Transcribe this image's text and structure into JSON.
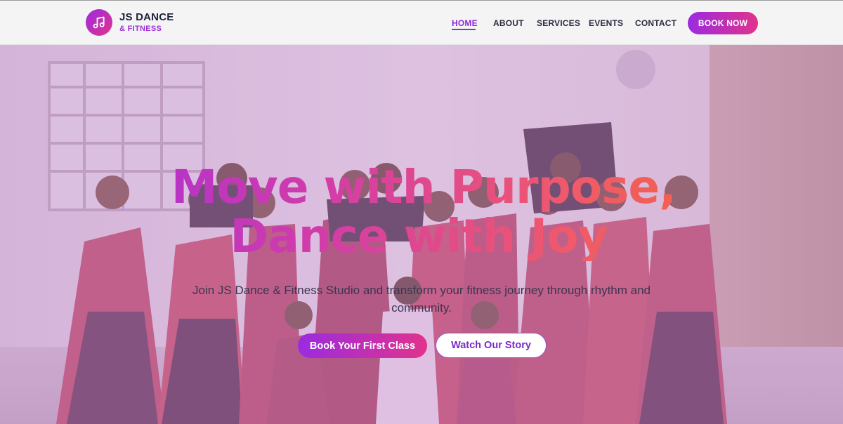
{
  "brand": {
    "name": "JS DANCE",
    "tagline": "& FITNESS",
    "logo_icon": "music-note-icon",
    "gradient": [
      "#9b2be0",
      "#e1338c"
    ]
  },
  "nav": {
    "items": [
      {
        "label": "HOME",
        "active": true
      },
      {
        "label": "ABOUT",
        "active": false
      },
      {
        "label": "SERVICES",
        "active": false
      },
      {
        "label": "EVENTS",
        "active": false
      },
      {
        "label": "CONTACT",
        "active": false
      }
    ],
    "cta": "BOOK NOW",
    "active_color": "#8a2be2"
  },
  "hero": {
    "headline_line1": "Move with Purpose,",
    "headline_line2": "Dance with Joy",
    "subtext": "Join JS Dance & Fitness Studio and transform your fitness journey through rhythm and community.",
    "primary_button": "Book Your First Class",
    "secondary_button": "Watch Our Story",
    "background_image": "group-dance-photo"
  }
}
